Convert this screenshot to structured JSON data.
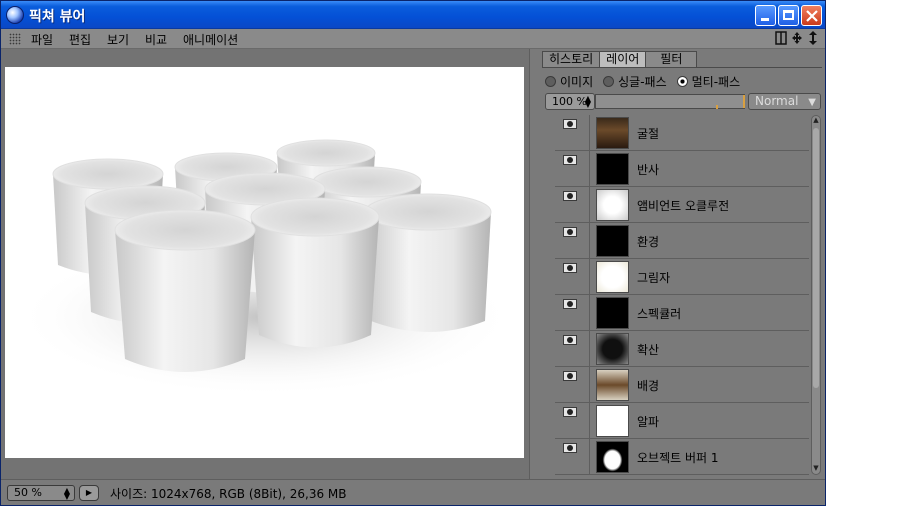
{
  "window": {
    "title": "픽쳐 뷰어",
    "icon": "picture-viewer-icon"
  },
  "menu": {
    "items": [
      "파일",
      "편집",
      "보기",
      "비교",
      "애니메이션"
    ]
  },
  "panel": {
    "tabs": [
      "히스토리",
      "레이어",
      "필터"
    ],
    "active_tab": "레이어",
    "radios": [
      {
        "label": "이미지",
        "selected": false
      },
      {
        "label": "싱글-패스",
        "selected": false
      },
      {
        "label": "멀티-패스",
        "selected": true
      }
    ],
    "opacity": "100 %",
    "blend_mode": "Normal",
    "layers": [
      {
        "name": "굴절",
        "thumb": "bronze"
      },
      {
        "name": "반사",
        "thumb": "black"
      },
      {
        "name": "앰비언트 오클루전",
        "thumb": "white-cups"
      },
      {
        "name": "환경",
        "thumb": "black"
      },
      {
        "name": "그림자",
        "thumb": "white-faint"
      },
      {
        "name": "스펙큘러",
        "thumb": "black"
      },
      {
        "name": "확산",
        "thumb": "dark-cups"
      },
      {
        "name": "배경",
        "thumb": "bronze-light"
      },
      {
        "name": "알파",
        "thumb": "white"
      },
      {
        "name": "오브젝트 버퍼 1",
        "thumb": "mask"
      }
    ]
  },
  "status": {
    "zoom": "50 %",
    "info": "사이즈: 1024x768, RGB (8Bit), 26,36 MB"
  },
  "colors": {
    "titlebar": "#0a5ddc",
    "panel_bg": "#7a7a7a",
    "accent_orange": "#d9a040"
  }
}
